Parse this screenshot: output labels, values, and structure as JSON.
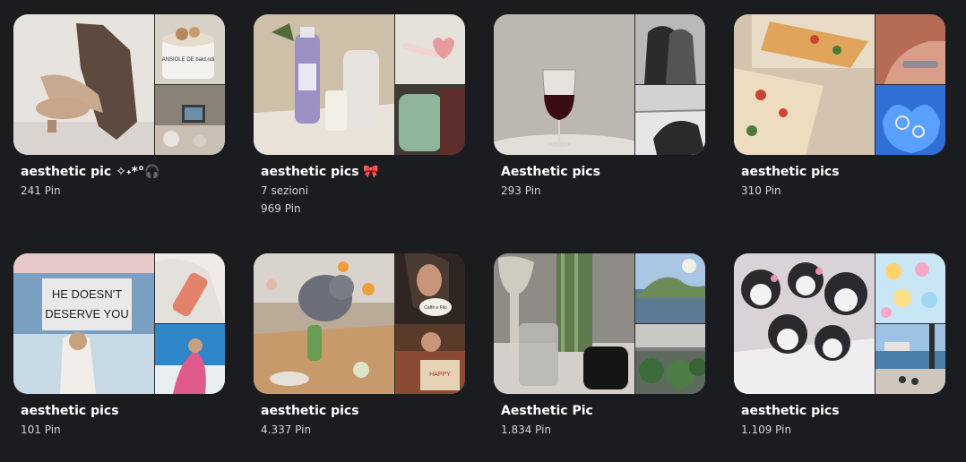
{
  "boards": [
    {
      "title": "aesthetic pic ✧˖*°🎧",
      "sections": "",
      "pins": "241 Pin"
    },
    {
      "title": "aesthetic pics 🎀",
      "sections": "7 sezioni",
      "pins": "969 Pin"
    },
    {
      "title": "Aesthetic pics",
      "sections": "",
      "pins": "293 Pin"
    },
    {
      "title": "aesthetic pics",
      "sections": "",
      "pins": "310 Pin"
    },
    {
      "title": "aesthetic pics",
      "sections": "",
      "pins": "101 Pin"
    },
    {
      "title": "aesthetic pics",
      "sections": "",
      "pins": "4.337 Pin"
    },
    {
      "title": "Aesthetic Pic",
      "sections": "",
      "pins": "1.834 Pin"
    },
    {
      "title": "aesthetic pics",
      "sections": "",
      "pins": "1.109 Pin"
    }
  ],
  "photo_text": {
    "mug": "ANSIOLE DE bald.ndi",
    "sign": "HE DOESN'T DESERVE YOU",
    "cup": "Caffè e Filo"
  }
}
